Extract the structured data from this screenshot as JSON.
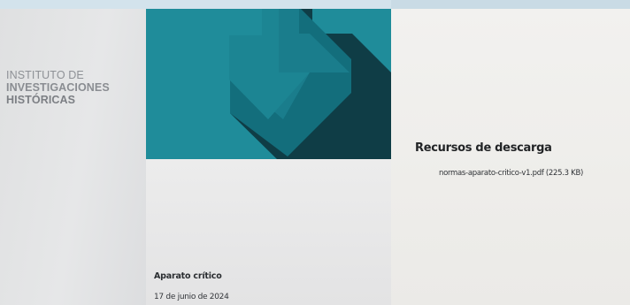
{
  "institute": {
    "line1": "INSTITUTO DE",
    "line2": "INVESTIGACIONES",
    "line3": "HISTÓRICAS"
  },
  "hero": {
    "icon": "download-arrow-icon",
    "colors": {
      "background": "#1f8c9a",
      "arrow": "#137584",
      "shadow": "#0f3d46"
    }
  },
  "document": {
    "title": "Aparato crítico",
    "date": "17 de junio de 2024"
  },
  "resources": {
    "heading": "Recursos de descarga",
    "file_link": "normas-aparato-critico-v1.pdf (225.3 KB)"
  }
}
